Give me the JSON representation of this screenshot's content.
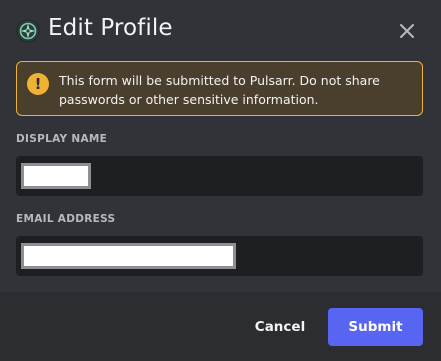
{
  "dialog": {
    "title": "Edit Profile",
    "app_icon": "compass-icon",
    "close_icon": "close-icon"
  },
  "warning": {
    "icon": "exclamation-icon",
    "text": "This form will be submitted to Pulsarr. Do not share passwords or other sensitive information."
  },
  "fields": {
    "display_name": {
      "label": "DISPLAY NAME",
      "value_redacted": true
    },
    "email": {
      "label": "EMAIL ADDRESS",
      "value_redacted": true
    }
  },
  "footer": {
    "cancel_label": "Cancel",
    "submit_label": "Submit"
  },
  "colors": {
    "background": "#313338",
    "footer_background": "#2b2d31",
    "input_background": "#1e1f22",
    "warning_border": "#f0b232",
    "primary_button": "#5865f2"
  }
}
